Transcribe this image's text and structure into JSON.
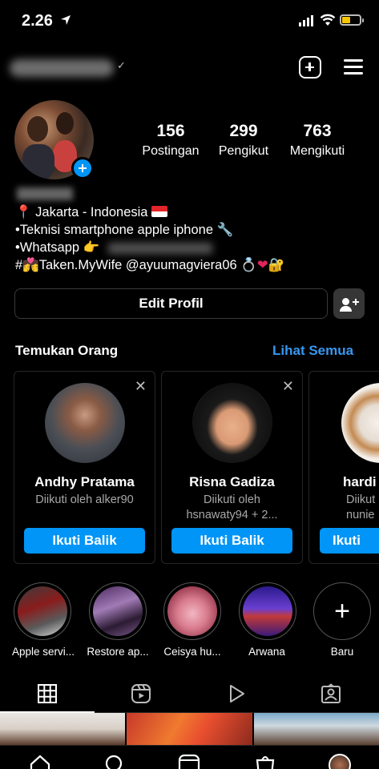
{
  "status_bar": {
    "time": "2.26"
  },
  "profile": {
    "stats": [
      {
        "value": "156",
        "label": "Postingan"
      },
      {
        "value": "299",
        "label": "Pengikut"
      },
      {
        "value": "763",
        "label": "Mengikuti"
      }
    ],
    "bio": {
      "location": "Jakarta - Indonesia",
      "line2": "•Teknisi smartphone  apple iphone",
      "line3": "•Whatsapp",
      "line4_hashtag": "#",
      "line4_text": "Taken.MyWife @ayuumagviera06"
    },
    "edit_button": "Edit Profil"
  },
  "discover": {
    "title": "Temukan Orang",
    "see_all": "Lihat Semua",
    "cards": [
      {
        "name": "Andhy Pratama",
        "sub1": "Diikuti oleh alker90",
        "sub2": "",
        "button": "Ikuti Balik"
      },
      {
        "name": "Risna Gadiza",
        "sub1": "Diikuti oleh",
        "sub2": "hsnawaty94 + 2...",
        "button": "Ikuti Balik"
      },
      {
        "name": "hardi",
        "sub1": "Diikut",
        "sub2": "nunie",
        "button": "Ikuti"
      }
    ]
  },
  "highlights": [
    {
      "label": "Apple servi..."
    },
    {
      "label": "Restore ap..."
    },
    {
      "label": "Ceisya hu..."
    },
    {
      "label": "Arwana"
    },
    {
      "label": "Baru"
    }
  ],
  "icons": {
    "header": [
      "new-post-icon",
      "menu-icon"
    ],
    "tabs": [
      "grid-icon",
      "reels-icon",
      "video-icon",
      "tagged-icon"
    ],
    "bottom_nav": [
      "home-icon",
      "search-icon",
      "reels-icon",
      "shop-icon",
      "profile-avatar"
    ]
  },
  "colors": {
    "accent": "#0095f6",
    "link": "#3897f0",
    "background": "#000000"
  }
}
